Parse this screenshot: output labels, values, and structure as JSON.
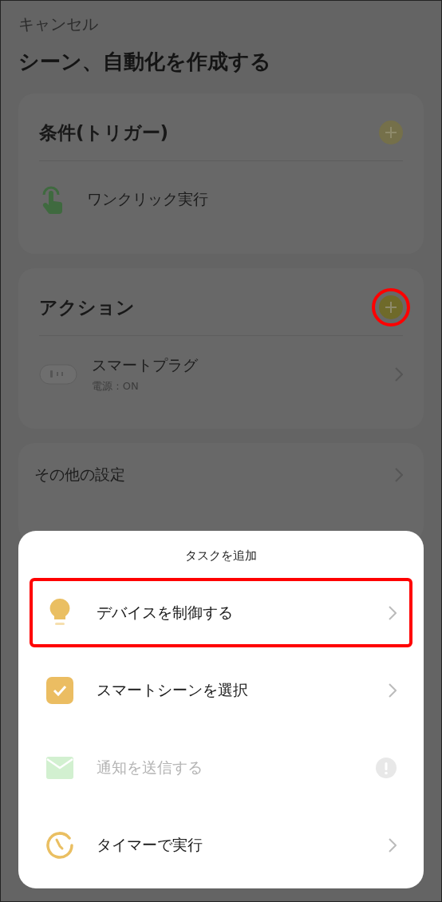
{
  "header": {
    "cancel": "キャンセル",
    "title": "シーン、自動化を作成する"
  },
  "trigger_card": {
    "title": "条件(トリガー)",
    "highlighted": false,
    "items": [
      {
        "label": "ワンクリック実行"
      }
    ]
  },
  "action_card": {
    "title": "アクション",
    "highlighted": true,
    "items": [
      {
        "label": "スマートプラグ",
        "detail": "電源 : ON"
      }
    ]
  },
  "other_settings": {
    "label": "その他の設定"
  },
  "sheet": {
    "title": "タスクを追加",
    "items": [
      {
        "kind": "device",
        "label": "デバイスを制御する",
        "disabled": false,
        "highlighted": true
      },
      {
        "kind": "scene",
        "label": "スマートシーンを選択",
        "disabled": false,
        "highlighted": false
      },
      {
        "kind": "notify",
        "label": "通知を送信する",
        "disabled": true,
        "highlighted": false
      },
      {
        "kind": "timer",
        "label": "タイマーで実行",
        "disabled": false,
        "highlighted": false
      }
    ]
  }
}
